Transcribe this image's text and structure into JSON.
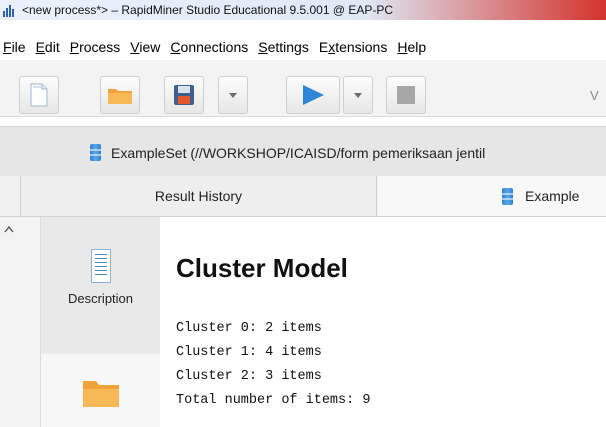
{
  "window": {
    "title": "<new process*> – RapidMiner Studio Educational 9.5.001 @ EAP-PC"
  },
  "menu": {
    "items": [
      {
        "label": "File"
      },
      {
        "label": "Edit"
      },
      {
        "label": "Process"
      },
      {
        "label": "View"
      },
      {
        "label": "Connections"
      },
      {
        "label": "Settings"
      },
      {
        "label": "Extensions"
      },
      {
        "label": "Help"
      }
    ]
  },
  "toolbar": {
    "right_label": "V"
  },
  "doc_tab": {
    "label": "ExampleSet (//WORKSHOP/ICAISD/form pemeriksaan jentil"
  },
  "result_tabs": {
    "history": "Result History",
    "example": "Example"
  },
  "side_nav": {
    "description": "Description"
  },
  "content": {
    "heading": "Cluster Model",
    "lines": [
      "Cluster 0: 2 items",
      "Cluster 1: 4 items",
      "Cluster 2: 3 items",
      "Total number of items: 9"
    ]
  },
  "icons": {
    "app": "rapidminer-icon",
    "new": "new-file-icon",
    "open": "open-folder-icon",
    "save": "save-icon",
    "run": "play-icon",
    "stop": "stop-icon",
    "example_set": "database-icon",
    "description": "document-icon",
    "folder": "folder-icon"
  },
  "colors": {
    "accent_blue": "#2f86d8",
    "folder_orange": "#f2a23a"
  }
}
